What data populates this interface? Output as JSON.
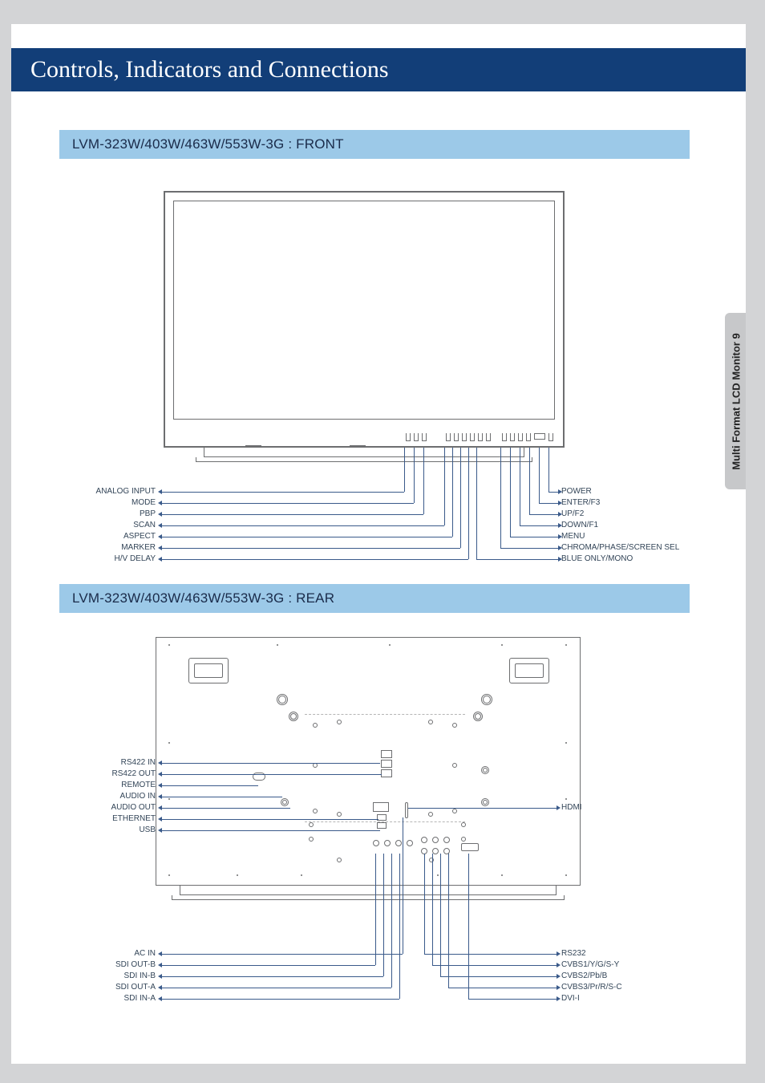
{
  "title": "Controls, Indicators and Connections",
  "side_tab": {
    "text": "Multi Format LCD Monitor",
    "page": "9"
  },
  "front": {
    "heading": "LVM-323W/403W/463W/553W-3G : FRONT",
    "left_labels": [
      "ANALOG INPUT",
      "MODE",
      "PBP",
      "SCAN",
      "ASPECT",
      "MARKER",
      "H/V DELAY"
    ],
    "right_labels": [
      "POWER",
      "ENTER/F3",
      "UP/F2",
      "DOWN/F1",
      "MENU",
      "CHROMA/PHASE/SCREEN SEL",
      "BLUE ONLY/MONO"
    ]
  },
  "rear": {
    "heading": "LVM-323W/403W/463W/553W-3G : REAR",
    "left_upper": [
      "RS422 IN",
      "RS422 OUT",
      "REMOTE",
      "AUDIO IN",
      "AUDIO OUT",
      "ETHERNET",
      "USB"
    ],
    "right_upper": [
      "HDMI"
    ],
    "left_lower": [
      "AC IN",
      "SDI OUT-B",
      "SDI IN-B",
      "SDI OUT-A",
      "SDI IN-A"
    ],
    "right_lower": [
      "RS232",
      "CVBS1/Y/G/S-Y",
      "CVBS2/Pb/B",
      "CVBS3/Pr/R/S-C",
      "DVI-I"
    ]
  }
}
